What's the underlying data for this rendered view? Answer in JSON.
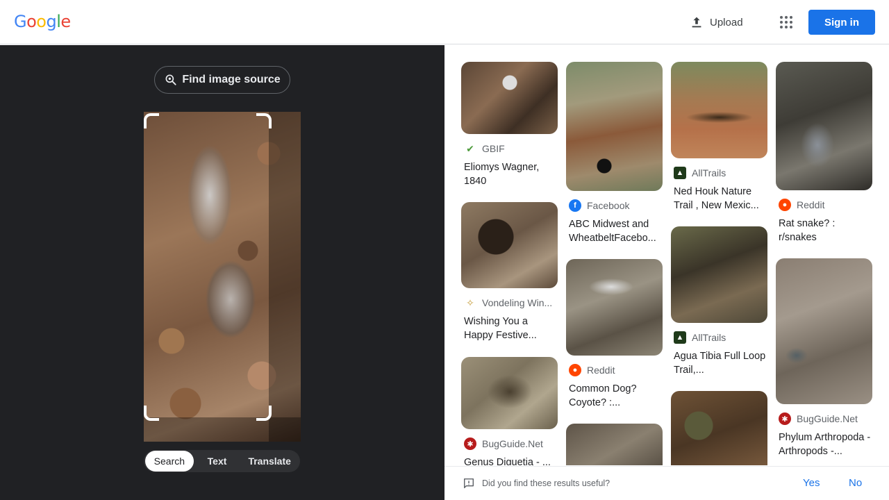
{
  "header": {
    "logo": [
      "G",
      "o",
      "o",
      "g",
      "l",
      "e"
    ],
    "logo_colors": [
      "#4285f4",
      "#ea4335",
      "#fbbc05",
      "#4285f4",
      "#34a853",
      "#ea4335"
    ],
    "upload_label": "Upload",
    "signin_label": "Sign in"
  },
  "left": {
    "find_source_label": "Find image source",
    "modes": [
      "Search",
      "Text",
      "Translate"
    ],
    "active_mode": "Search"
  },
  "results": [
    {
      "source": "GBIF",
      "icon": "gbif-icon",
      "title": "Eliomys Wagner, 1840"
    },
    {
      "source": "Vondeling Win...",
      "icon": "vondeling-icon",
      "title": "Wishing You a Happy Festive..."
    },
    {
      "source": "BugGuide.Net",
      "icon": "bugguide-icon",
      "title": "Genus Diguetia - ..."
    },
    {
      "source": "Facebook",
      "icon": "facebook-icon",
      "title": "ABC Midwest and WheatbeltFacebo..."
    },
    {
      "source": "Reddit",
      "icon": "reddit-icon",
      "title": "Common Dog? Coyote? :..."
    },
    {
      "source": "AllTrails",
      "icon": "alltrails-icon",
      "title": "Ned Houk Nature Trail , New Mexic..."
    },
    {
      "source": "AllTrails",
      "icon": "alltrails-icon",
      "title": "Agua Tibia Full Loop Trail,..."
    },
    {
      "source": "Reddit",
      "icon": "reddit-icon",
      "title": "Rat snake? : r/snakes"
    },
    {
      "source": "BugGuide.Net",
      "icon": "bugguide-icon",
      "title": "Phylum Arthropoda - Arthropods -..."
    }
  ],
  "feedback": {
    "question": "Did you find these results useful?",
    "yes": "Yes",
    "no": "No"
  }
}
